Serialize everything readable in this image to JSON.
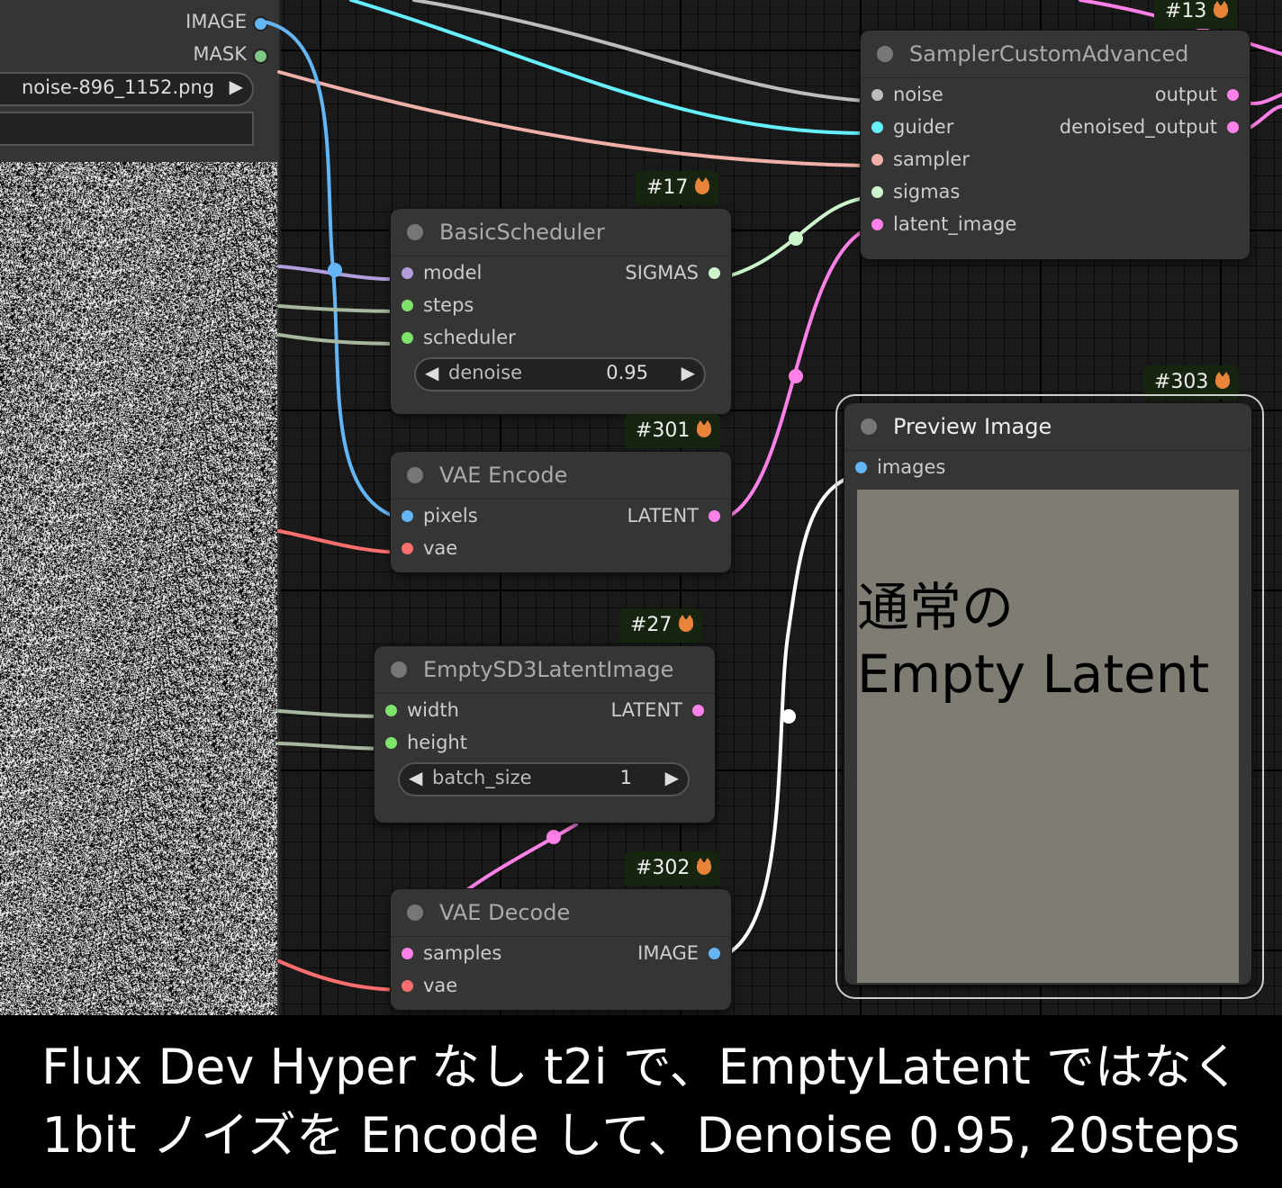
{
  "left_panel": {
    "outputs": [
      {
        "label": "IMAGE",
        "color": "#64b5f6"
      },
      {
        "label": "MASK",
        "color": "#81c784"
      }
    ],
    "filename": "noise-896_1152.png",
    "play_icon": "play-triangle-icon"
  },
  "nodes": {
    "sampler": {
      "badge": "#13",
      "title": "SamplerCustomAdvanced",
      "inputs": [
        {
          "label": "noise",
          "color": "#bdbdbd"
        },
        {
          "label": "guider",
          "color": "#66f0ff"
        },
        {
          "label": "sampler",
          "color": "#f0b0a8"
        },
        {
          "label": "sigmas",
          "color": "#ccf5cc"
        },
        {
          "label": "latent_image",
          "color": "#ff80e8"
        }
      ],
      "outputs": [
        {
          "label": "output",
          "color": "#ff80e8"
        },
        {
          "label": "denoised_output",
          "color": "#ff80e8"
        }
      ]
    },
    "scheduler": {
      "badge": "#17",
      "title": "BasicScheduler",
      "inputs": [
        {
          "label": "model",
          "color": "#b39ddb"
        },
        {
          "label": "steps",
          "color": "#7de36b"
        },
        {
          "label": "scheduler",
          "color": "#7de36b"
        }
      ],
      "output": {
        "label": "SIGMAS",
        "color": "#ccf5cc"
      },
      "widget": {
        "label": "denoise",
        "value": "0.95"
      }
    },
    "vae_encode": {
      "badge": "#301",
      "title": "VAE Encode",
      "inputs": [
        {
          "label": "pixels",
          "color": "#64b5f6"
        },
        {
          "label": "vae",
          "color": "#ff6e6e"
        }
      ],
      "output": {
        "label": "LATENT",
        "color": "#ff80e8"
      }
    },
    "empty_latent": {
      "badge": "#27",
      "title": "EmptySD3LatentImage",
      "inputs": [
        {
          "label": "width",
          "color": "#7de36b"
        },
        {
          "label": "height",
          "color": "#7de36b"
        }
      ],
      "output": {
        "label": "LATENT",
        "color": "#ff80e8"
      },
      "widget": {
        "label": "batch_size",
        "value": "1"
      }
    },
    "vae_decode": {
      "badge": "#302",
      "title": "VAE Decode",
      "inputs": [
        {
          "label": "samples",
          "color": "#ff80e8"
        },
        {
          "label": "vae",
          "color": "#ff6e6e"
        }
      ],
      "output": {
        "label": "IMAGE",
        "color": "#64b5f6"
      }
    },
    "preview": {
      "badge": "#303",
      "title": "Preview Image",
      "input": {
        "label": "images",
        "color": "#64b5f6"
      },
      "overlay_line1": "通常の",
      "overlay_line2": "Empty Latent",
      "image_color": "#7f7c74"
    }
  },
  "caption": {
    "line1": "Flux Dev Hyper なし t2i で、EmptyLatent ではなく",
    "line2": "1bit ノイズを Encode して、Denoise 0.95, 20steps"
  }
}
